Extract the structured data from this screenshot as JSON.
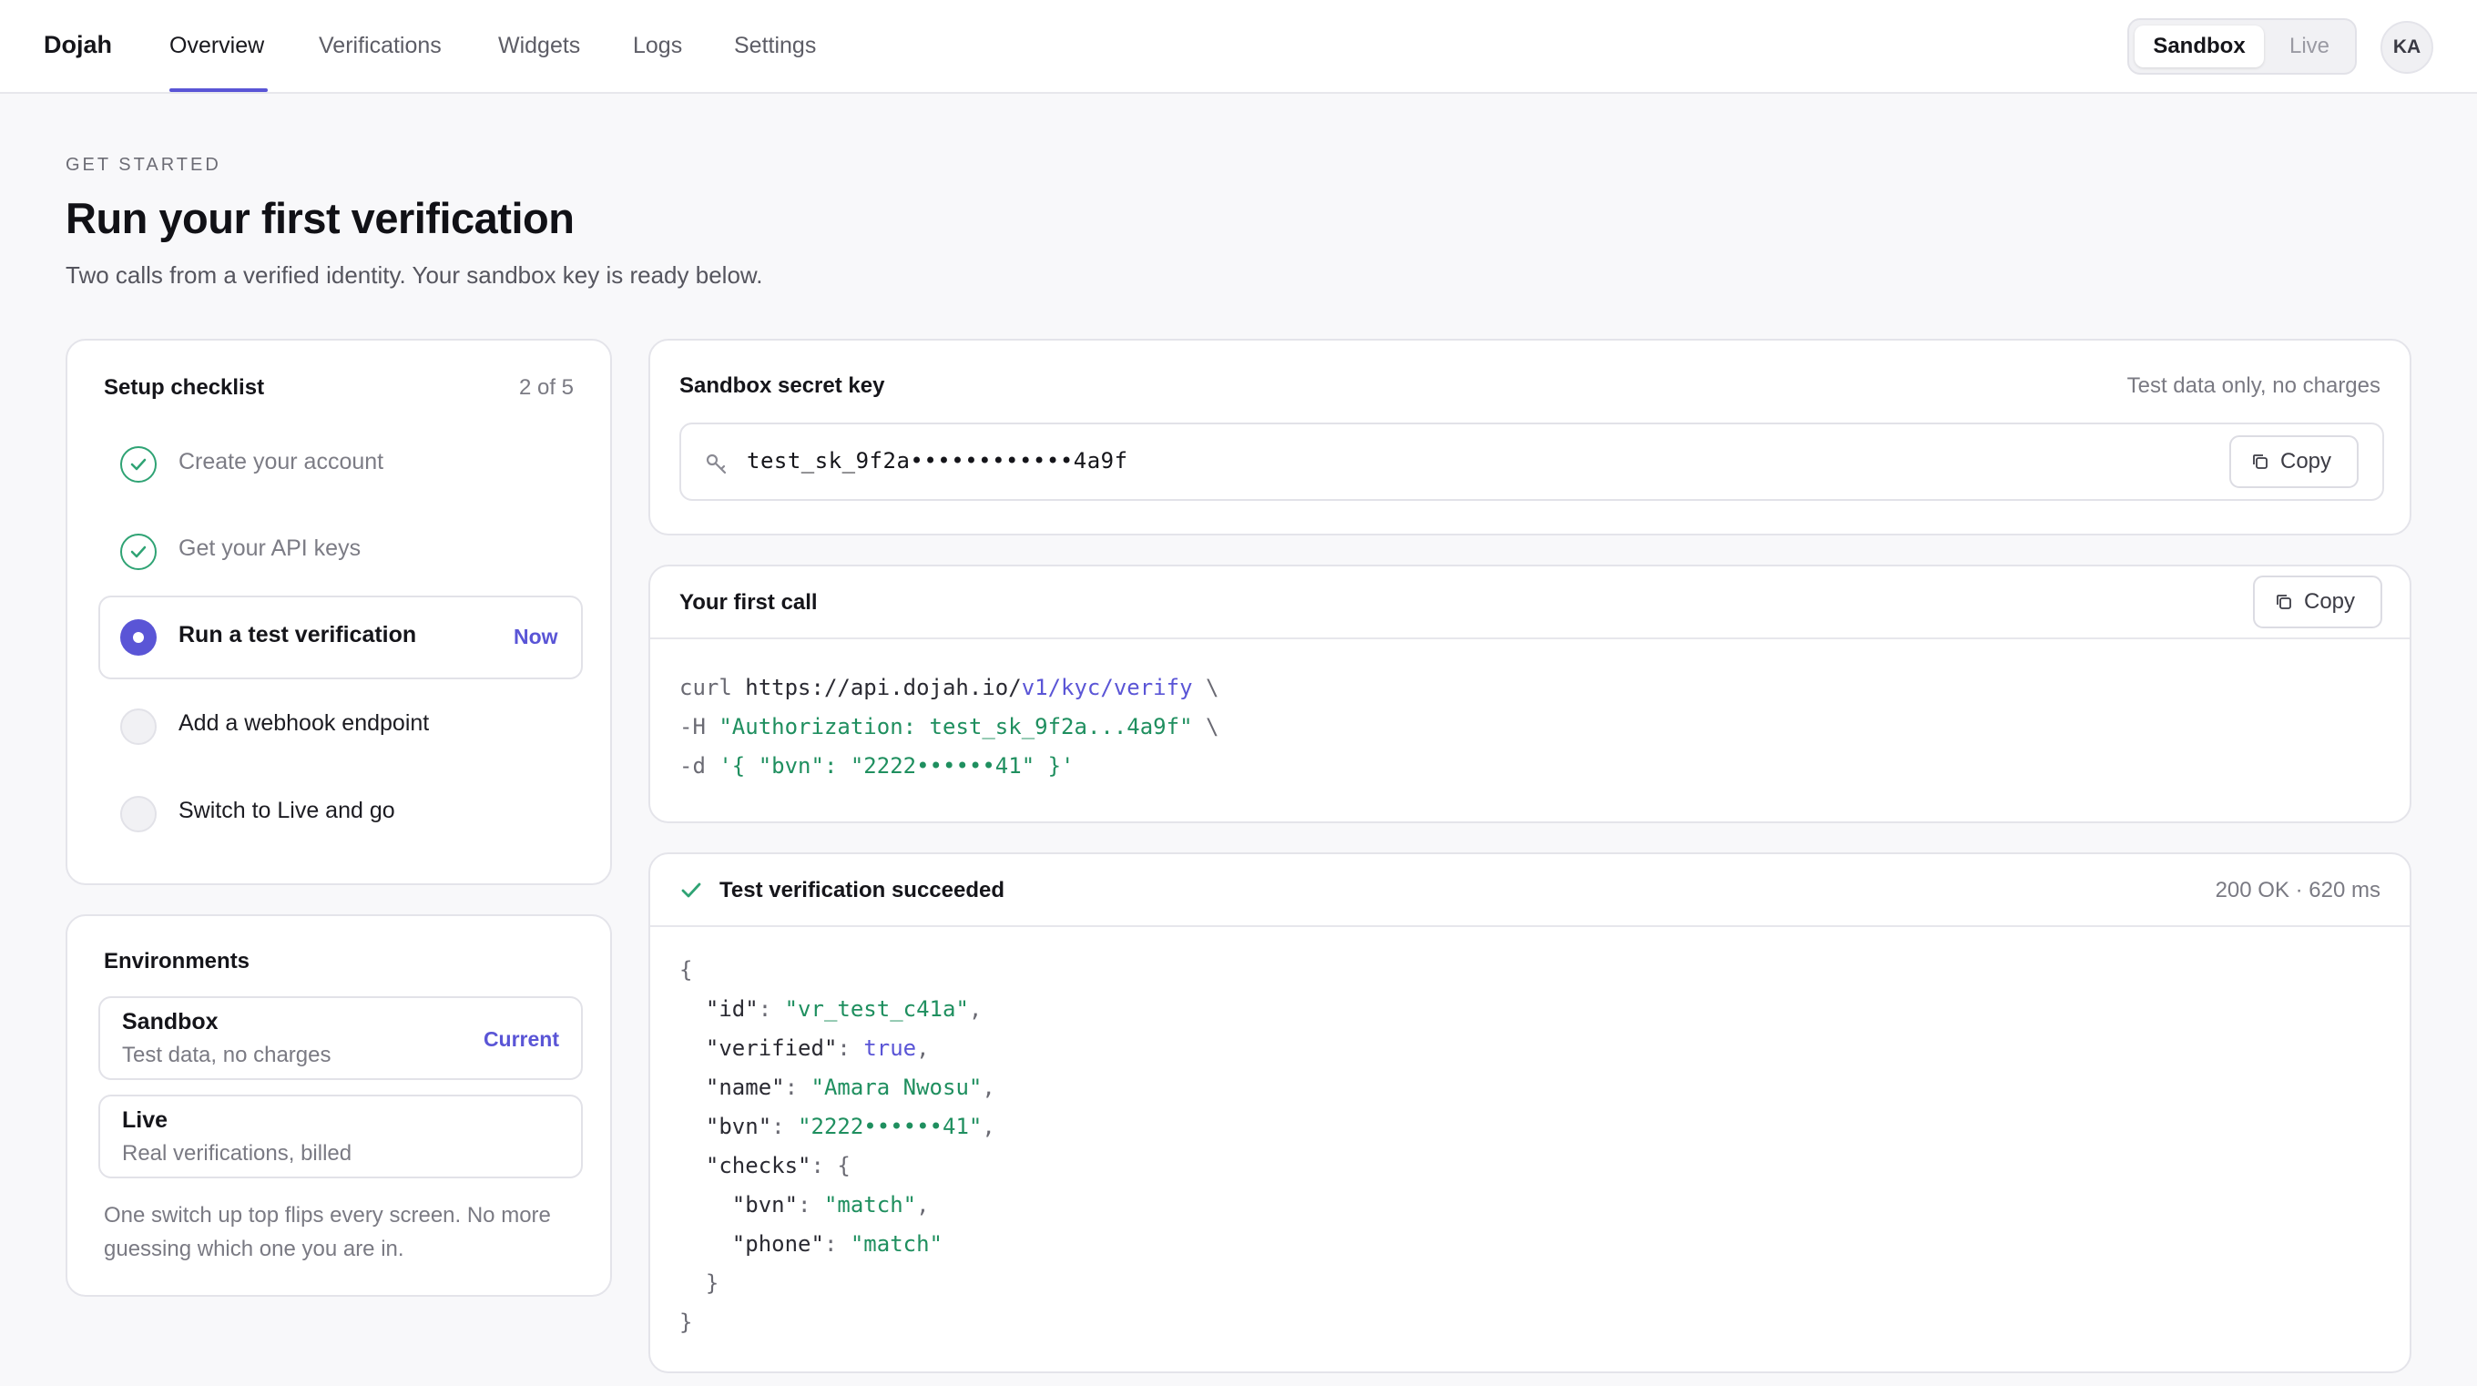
{
  "nav": {
    "brand": "Dojah",
    "tabs": [
      {
        "label": "Overview",
        "active": true
      },
      {
        "label": "Verifications",
        "active": false
      },
      {
        "label": "Widgets",
        "active": false
      },
      {
        "label": "Logs",
        "active": false
      },
      {
        "label": "Settings",
        "active": false
      }
    ],
    "env_toggle": {
      "options": [
        "Sandbox",
        "Live"
      ],
      "selected": "Sandbox"
    },
    "avatar_initials": "KA"
  },
  "header": {
    "eyebrow": "GET STARTED",
    "title": "Run your first verification",
    "subtitle": "Two calls from a verified identity. Your sandbox key is ready below."
  },
  "checklist": {
    "title": "Setup checklist",
    "progress": "2 of 5",
    "items": [
      {
        "label": "Create your account",
        "status": "done"
      },
      {
        "label": "Get your API keys",
        "status": "done"
      },
      {
        "label": "Run a test verification",
        "status": "current",
        "badge": "Now"
      },
      {
        "label": "Add a webhook endpoint",
        "status": "todo"
      },
      {
        "label": "Switch to Live and go",
        "status": "todo"
      }
    ]
  },
  "environments": {
    "title": "Environments",
    "items": [
      {
        "name": "Sandbox",
        "description": "Test data, no charges",
        "badge": "Current"
      },
      {
        "name": "Live",
        "description": "Real verifications, billed"
      }
    ],
    "note": "One switch up top flips every screen. No more guessing which one you are in."
  },
  "secret_key": {
    "title": "Sandbox secret key",
    "hint": "Test data only, no charges",
    "value": "test_sk_9f2a••••••••••••4a9f",
    "copy_label": "Copy"
  },
  "first_call": {
    "title": "Your first call",
    "copy_label": "Copy",
    "lines": {
      "l1_cmd": "curl",
      "l1_host": " https://api.dojah.io/",
      "l1_path": "v1/kyc/verify",
      "l1_cont": " \\",
      "l2_flag": "-H ",
      "l2_val": "\"Authorization: test_sk_9f2a...4a9f\"",
      "l2_cont": " \\",
      "l3_flag": "-d ",
      "l3_val": "'{ \"bvn\": \"2222••••••41\" }'"
    }
  },
  "result": {
    "title": "Test verification succeeded",
    "meta": "200 OK · 620 ms",
    "json": {
      "id": "\"vr_test_c41a\"",
      "verified": "true",
      "name": "\"Amara Nwosu\"",
      "bvn": "\"2222••••••41\"",
      "checks_bvn": "\"match\"",
      "checks_phone": "\"match\""
    }
  },
  "colors": {
    "accent": "#5a55d6",
    "success": "#2fa374",
    "string": "#1f8f5f"
  }
}
